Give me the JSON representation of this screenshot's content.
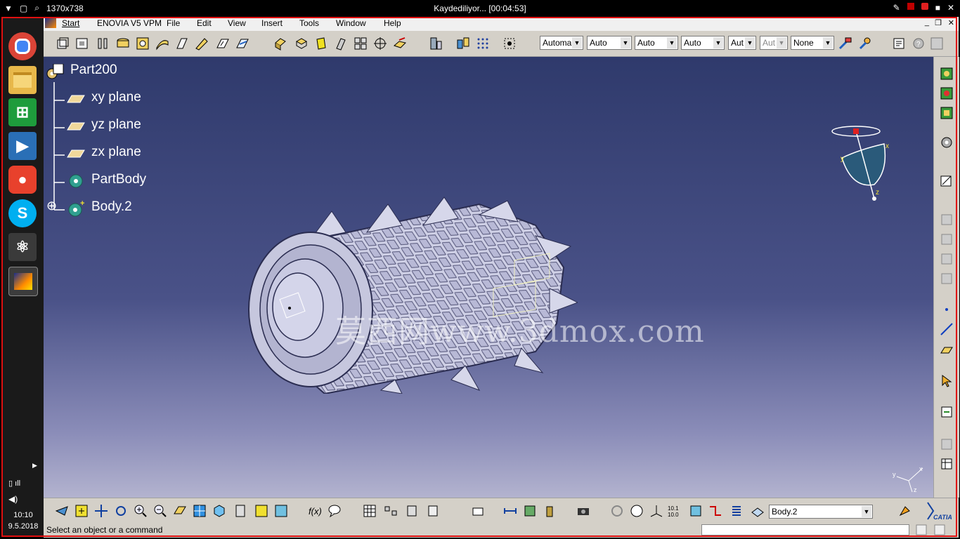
{
  "recorder": {
    "size": "1370x738",
    "status": "Kaydediliyor... [00:04:53]"
  },
  "taskbar": {
    "apps": [
      "Chrome",
      "File Explorer",
      "Store",
      "Media Player",
      "Baidu",
      "Skype",
      "Atom",
      "CATIA"
    ],
    "time": "10:10",
    "date": "9.5.2018"
  },
  "menu": {
    "items": [
      "Start",
      "ENOVIA V5 VPM",
      "File",
      "Edit",
      "View",
      "Insert",
      "Tools",
      "Window",
      "Help"
    ]
  },
  "toolbar": {
    "combos": [
      "Automa",
      "Auto",
      "Auto",
      "Auto",
      "Aut",
      "Aut",
      "None"
    ]
  },
  "tree": {
    "root": "Part200",
    "items": [
      "xy plane",
      "yz plane",
      "zx plane",
      "PartBody",
      "Body.2"
    ]
  },
  "compass": {
    "x": "x",
    "y": "y",
    "z": "z"
  },
  "watermark": "莫西网www.3dmox.com",
  "bottombar": {
    "body_select": "Body.2"
  },
  "status": {
    "message": "Select an object or a command"
  },
  "colors": {
    "viewport_top": "#2f3a6c",
    "viewport_bottom": "#b3b3cf",
    "frame": "#e01010"
  }
}
